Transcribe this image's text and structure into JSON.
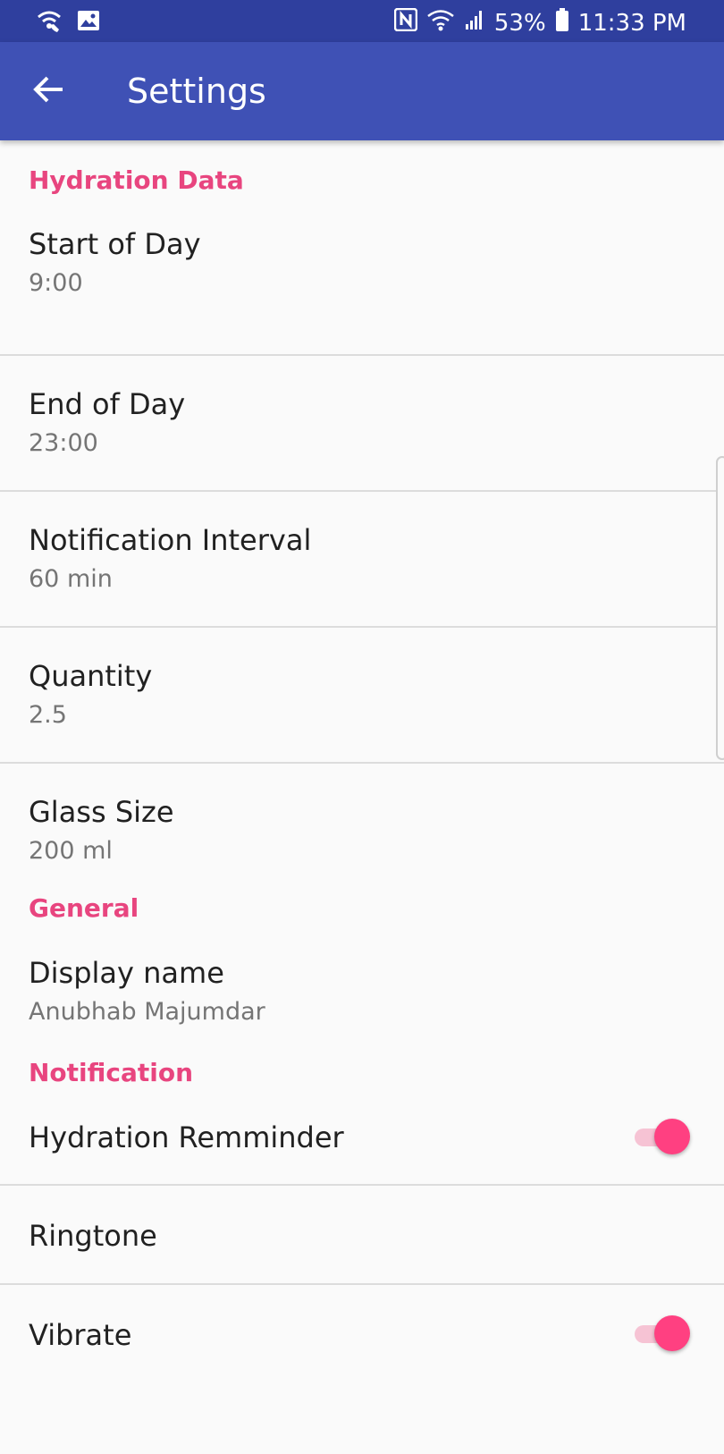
{
  "status_bar": {
    "battery": "53%",
    "time": "11:33 PM",
    "icons_left": [
      "wifi-call-icon",
      "image-icon"
    ],
    "icons_right": [
      "nfc-icon",
      "wifi-icon",
      "signal-icon",
      "battery-icon"
    ]
  },
  "app_bar": {
    "title": "Settings",
    "color": "#3f51b5",
    "status_color": "#2f3f9e"
  },
  "accent_color": "#e8457f",
  "sections": {
    "hydration": {
      "header": "Hydration Data",
      "start_of_day": {
        "title": "Start of Day",
        "value": "9:00"
      },
      "end_of_day": {
        "title": "End of Day",
        "value": "23:00"
      },
      "notification_interval": {
        "title": "Notification Interval",
        "value": "60 min"
      },
      "quantity": {
        "title": "Quantity",
        "value": "2.5"
      },
      "glass_size": {
        "title": "Glass Size",
        "value": "200 ml"
      }
    },
    "general": {
      "header": "General",
      "display_name": {
        "title": "Display name",
        "value": "Anubhab Majumdar"
      }
    },
    "notification": {
      "header": "Notification",
      "hydration_reminder": {
        "title": "Hydration Remminder",
        "enabled": true
      },
      "ringtone": {
        "title": "Ringtone"
      },
      "vibrate": {
        "title": "Vibrate",
        "enabled": true
      }
    }
  }
}
